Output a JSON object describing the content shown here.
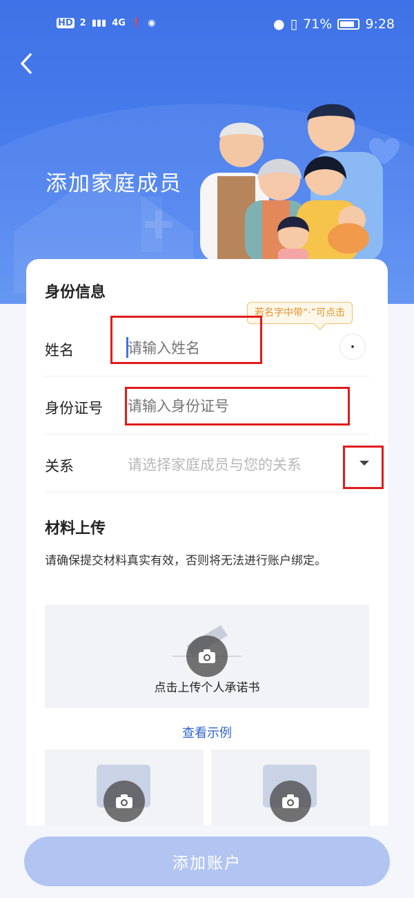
{
  "status_bar": {
    "left_badges": [
      "HD",
      "2",
      "4G"
    ],
    "battery": "71%",
    "time": "9:28"
  },
  "header": {
    "title": "添加家庭成员"
  },
  "identity": {
    "section_title": "身份信息",
    "tooltip": "若名字中带“·”可点击",
    "dot_label": "·",
    "name_label": "姓名",
    "name_placeholder": "请输入姓名",
    "id_label": "身份证号",
    "id_placeholder": "请输入身份证号",
    "relation_label": "关系",
    "relation_placeholder": "请选择家庭成员与您的关系"
  },
  "upload": {
    "section_title": "材料上传",
    "description": "请确保提交材料真实有效，否则将无法进行账户绑定。",
    "promise_label": "点击上传个人承诺书",
    "example_link": "查看示例"
  },
  "footer": {
    "submit_label": "添加账户"
  },
  "colors": {
    "primary": "#3f72e6",
    "button_disabled": "#b2c5f2",
    "highlight": "#e01b1b",
    "tooltip_text": "#e0902a"
  }
}
